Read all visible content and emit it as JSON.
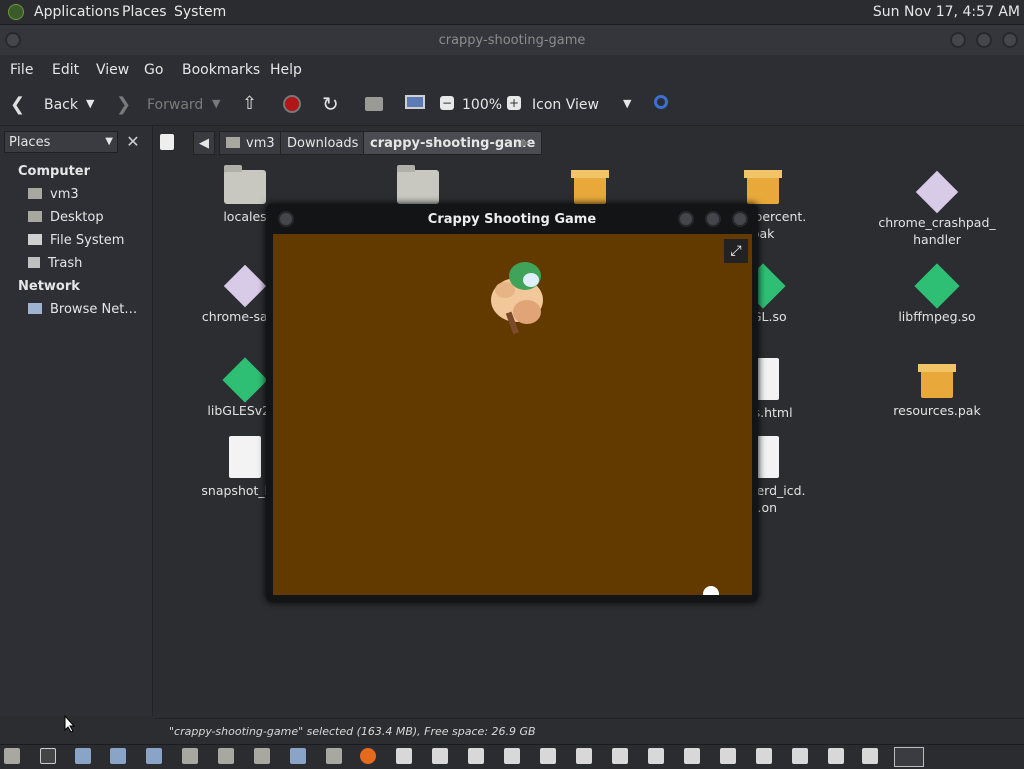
{
  "top_panel": {
    "menus": [
      "Applications",
      "Places",
      "System"
    ],
    "clock": "Sun Nov 17,  4:57 AM"
  },
  "window": {
    "title": "crappy-shooting-game"
  },
  "menubar": [
    "File",
    "Edit",
    "View",
    "Go",
    "Bookmarks",
    "Help"
  ],
  "toolbar": {
    "back_label": "Back",
    "forward_label": "Forward",
    "zoom": "100%",
    "view_mode": "Icon View"
  },
  "sidebar": {
    "selector": "Places",
    "computer_heading": "Computer",
    "computer_items": [
      "vm3",
      "Desktop",
      "File System",
      "Trash"
    ],
    "network_heading": "Network",
    "network_items": [
      "Browse Net…"
    ]
  },
  "pathbar": {
    "crumbs": [
      "vm3",
      "Downloads",
      "crappy-shooting-game"
    ]
  },
  "files": [
    {
      "name": "locales",
      "type": "folder"
    },
    {
      "name": "",
      "type": "folder"
    },
    {
      "name": "",
      "type": "package"
    },
    {
      "name": "…00_percent.\npak",
      "type": "package"
    },
    {
      "name": "chrome_crashpad_\nhandler",
      "type": "executable"
    },
    {
      "name": "chrome-san…",
      "type": "executable"
    },
    {
      "name": "…GL.so",
      "type": "library"
    },
    {
      "name": "libffmpeg.so",
      "type": "library"
    },
    {
      "name": "libGLESv2…",
      "type": "library"
    },
    {
      "name": "…es.html",
      "type": "document"
    },
    {
      "name": "resources.pak",
      "type": "package"
    },
    {
      "name": "snapshot_bl…",
      "type": "document"
    },
    {
      "name": "…haderd_icd.\n…on",
      "type": "document"
    }
  ],
  "status": "\"crappy-shooting-game\" selected (163.4 MB), Free space: 26.9 GB",
  "game": {
    "title": "Crappy Shooting Game",
    "background_color": "#623a00"
  }
}
